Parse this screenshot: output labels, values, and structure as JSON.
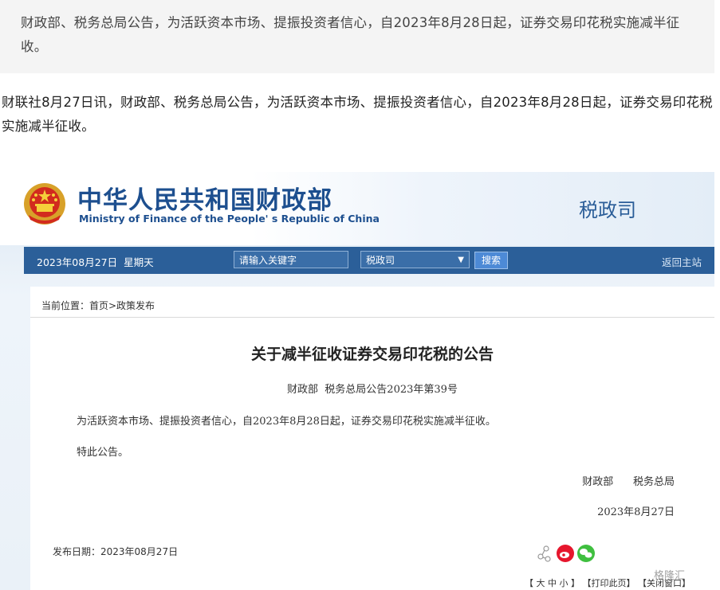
{
  "quote": {
    "text": "财政部、税务总局公告，为活跃资本市场、提振投资者信心，自2023年8月28日起，证券交易印花税实施减半征收。"
  },
  "article": {
    "text": "财联社8月27日讯，财政部、税务总局公告，为活跃资本市场、提振投资者信心，自2023年8月28日起，证券交易印花税实施减半征收。"
  },
  "site": {
    "name_cn": "中华人民共和国财政部",
    "name_en": "Ministry of Finance of the People' s Republic of China",
    "department": "税政司"
  },
  "nav": {
    "date": "2023年08月27日  星期天",
    "search_placeholder": "请输入关键字",
    "select_value": "税政司",
    "search_button": "搜索",
    "home_link": "返回主站"
  },
  "breadcrumb": "当前位置：首页>政策发布",
  "doc": {
    "title": "关于减半征收证券交易印花税的公告",
    "number": "财政部  税务总局公告2023年第39号",
    "para1": "为活跃资本市场、提振投资者信心，自2023年8月28日起，证券交易印花税实施减半征收。",
    "para2": "特此公告。",
    "signature": "财政部      税务总局",
    "sign_date": "2023年8月27日",
    "publish_date": "发布日期：2023年08月27日",
    "tools": "【 大 中 小 】 【打印此页】 【关闭窗口】"
  },
  "watermark": "格隆汇",
  "colors": {
    "brand_blue": "#2b5f99",
    "title_blue": "#1d4f8f",
    "weibo_red": "#e6162d",
    "wechat_green": "#3fbf3f"
  }
}
